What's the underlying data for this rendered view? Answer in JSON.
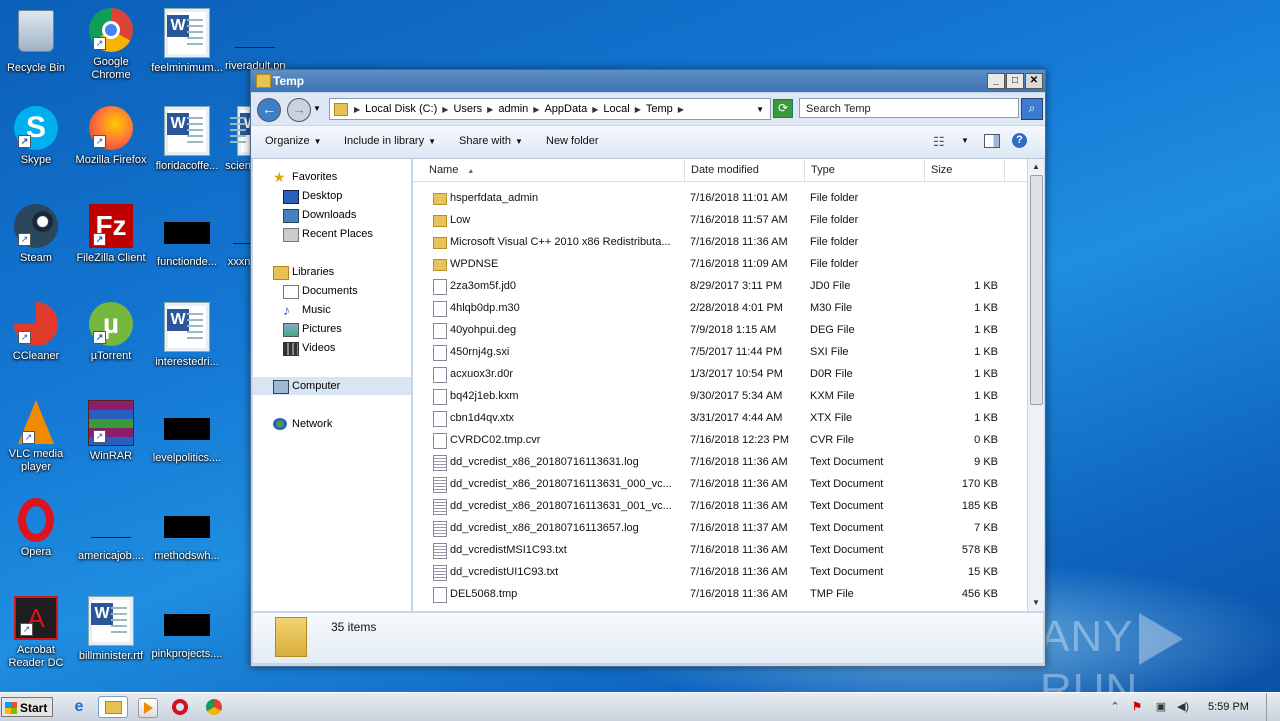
{
  "desktop": {
    "icons": [
      {
        "label": "Recycle Bin"
      },
      {
        "label": "Google Chrome"
      },
      {
        "label": "feelminimum..."
      },
      {
        "label": "riveradult.png"
      },
      {
        "label": "Skype"
      },
      {
        "label": "Mozilla Firefox"
      },
      {
        "label": "floridacoffe..."
      },
      {
        "label": "scien"
      },
      {
        "label": "Steam"
      },
      {
        "label": "FileZilla Client"
      },
      {
        "label": "functionde..."
      },
      {
        "label": "xxxn"
      },
      {
        "label": "CCleaner"
      },
      {
        "label": "µTorrent"
      },
      {
        "label": "interestedri..."
      },
      {
        "label": "VLC media player"
      },
      {
        "label": "WinRAR"
      },
      {
        "label": "levelpolitics...."
      },
      {
        "label": "Opera"
      },
      {
        "label": "americajob...."
      },
      {
        "label": "methodswh..."
      },
      {
        "label": "Acrobat Reader DC"
      },
      {
        "label": "billminister.rtf"
      },
      {
        "label": "pinkprojects...."
      }
    ]
  },
  "window": {
    "title": "Temp",
    "buttons": {
      "minimize": "_",
      "maximize": "□",
      "close": "✕"
    },
    "address": {
      "crumbs": [
        "Local Disk (C:)",
        "Users",
        "admin",
        "AppData",
        "Local",
        "Temp"
      ]
    },
    "search": {
      "placeholder": "Search Temp"
    },
    "toolbar": {
      "organize": "Organize",
      "include_in_library": "Include in library",
      "share_with": "Share with",
      "new_folder": "New folder"
    },
    "nav": {
      "favorites": "Favorites",
      "desktop": "Desktop",
      "downloads": "Downloads",
      "recent_places": "Recent Places",
      "libraries": "Libraries",
      "documents": "Documents",
      "music": "Music",
      "pictures": "Pictures",
      "videos": "Videos",
      "computer": "Computer",
      "network": "Network"
    },
    "columns": {
      "name": "Name",
      "date_modified": "Date modified",
      "type": "Type",
      "size": "Size"
    },
    "files": [
      {
        "name": "hsperfdata_admin",
        "date": "7/16/2018 11:01 AM",
        "type": "File folder",
        "size": "",
        "kind": "folder"
      },
      {
        "name": "Low",
        "date": "7/16/2018 11:57 AM",
        "type": "File folder",
        "size": "",
        "kind": "folder"
      },
      {
        "name": "Microsoft Visual C++ 2010  x86 Redistributa...",
        "date": "7/16/2018 11:36 AM",
        "type": "File folder",
        "size": "",
        "kind": "folder"
      },
      {
        "name": "WPDNSE",
        "date": "7/16/2018 11:09 AM",
        "type": "File folder",
        "size": "",
        "kind": "folder"
      },
      {
        "name": "2za3om5f.jd0",
        "date": "8/29/2017 3:11 PM",
        "type": "JD0 File",
        "size": "1 KB",
        "kind": "file"
      },
      {
        "name": "4hlqb0dp.m30",
        "date": "2/28/2018 4:01 PM",
        "type": "M30 File",
        "size": "1 KB",
        "kind": "file"
      },
      {
        "name": "40yohpui.deg",
        "date": "7/9/2018 1:15 AM",
        "type": "DEG File",
        "size": "1 KB",
        "kind": "file"
      },
      {
        "name": "450rnj4g.sxi",
        "date": "7/5/2017 11:44 PM",
        "type": "SXI File",
        "size": "1 KB",
        "kind": "file"
      },
      {
        "name": "acxuox3r.d0r",
        "date": "1/3/2017 10:54 PM",
        "type": "D0R File",
        "size": "1 KB",
        "kind": "file"
      },
      {
        "name": "bq42j1eb.kxm",
        "date": "9/30/2017 5:34 AM",
        "type": "KXM File",
        "size": "1 KB",
        "kind": "file"
      },
      {
        "name": "cbn1d4qv.xtx",
        "date": "3/31/2017 4:44 AM",
        "type": "XTX File",
        "size": "1 KB",
        "kind": "file"
      },
      {
        "name": "CVRDC02.tmp.cvr",
        "date": "7/16/2018 12:23 PM",
        "type": "CVR File",
        "size": "0 KB",
        "kind": "file"
      },
      {
        "name": "dd_vcredist_x86_20180716113631.log",
        "date": "7/16/2018 11:36 AM",
        "type": "Text Document",
        "size": "9 KB",
        "kind": "txt"
      },
      {
        "name": "dd_vcredist_x86_20180716113631_000_vc...",
        "date": "7/16/2018 11:36 AM",
        "type": "Text Document",
        "size": "170 KB",
        "kind": "txt"
      },
      {
        "name": "dd_vcredist_x86_20180716113631_001_vc...",
        "date": "7/16/2018 11:36 AM",
        "type": "Text Document",
        "size": "185 KB",
        "kind": "txt"
      },
      {
        "name": "dd_vcredist_x86_20180716113657.log",
        "date": "7/16/2018 11:37 AM",
        "type": "Text Document",
        "size": "7 KB",
        "kind": "txt"
      },
      {
        "name": "dd_vcredistMSI1C93.txt",
        "date": "7/16/2018 11:36 AM",
        "type": "Text Document",
        "size": "578 KB",
        "kind": "txt"
      },
      {
        "name": "dd_vcredistUI1C93.txt",
        "date": "7/16/2018 11:36 AM",
        "type": "Text Document",
        "size": "15 KB",
        "kind": "txt"
      },
      {
        "name": "DEL5068.tmp",
        "date": "7/16/2018 11:36 AM",
        "type": "TMP File",
        "size": "456 KB",
        "kind": "file"
      }
    ],
    "status": {
      "item_count": "35 items"
    }
  },
  "watermark": {
    "left": "ANY",
    "right": "RUN"
  },
  "taskbar": {
    "start_label": "Start",
    "clock": "5:59 PM"
  }
}
